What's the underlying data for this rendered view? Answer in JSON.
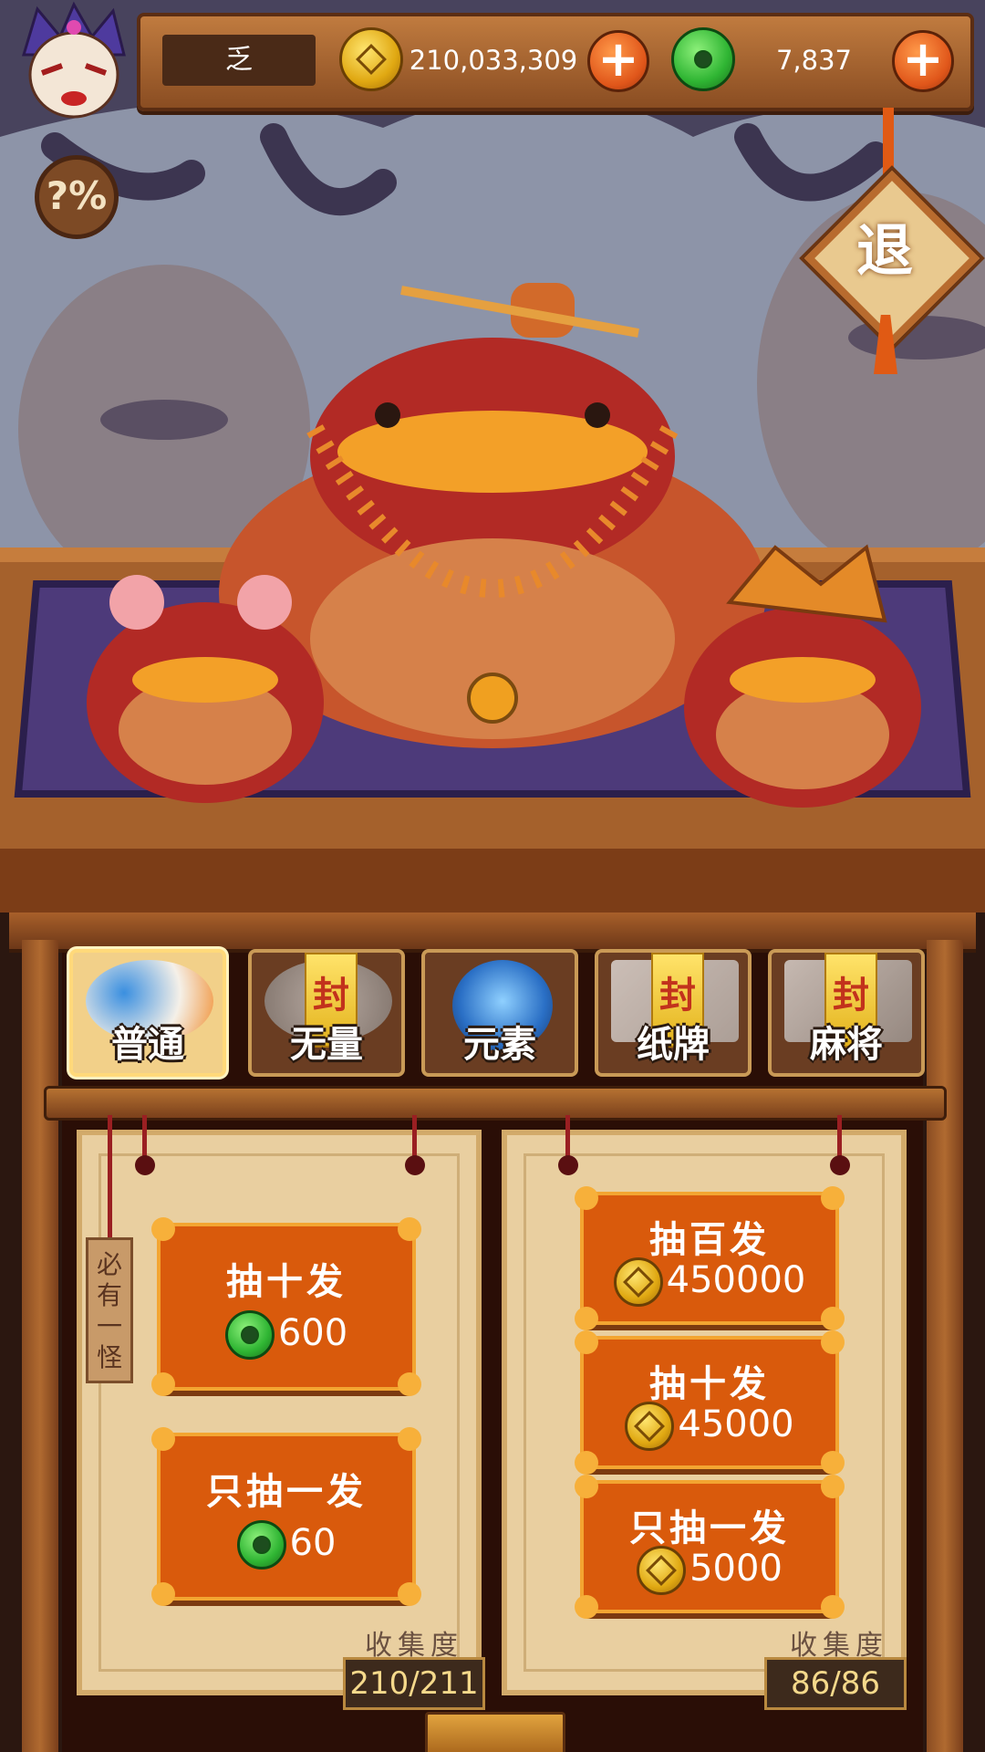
{
  "header": {
    "player_name": "乏",
    "gold": "210,033,309",
    "jade": "7,837",
    "add_symbol": "+"
  },
  "side_buttons": {
    "help_label": "?%",
    "exit_label": "退"
  },
  "tabs": [
    {
      "label": "普通",
      "locked": false,
      "selected": true
    },
    {
      "label": "无量",
      "locked": true,
      "selected": false
    },
    {
      "label": "元素",
      "locked": false,
      "selected": false
    },
    {
      "label": "纸牌",
      "locked": true,
      "selected": false
    },
    {
      "label": "麻将",
      "locked": true,
      "selected": false
    }
  ],
  "seal_char": "封",
  "left_panel": {
    "guarantee_tag": "必有一怪",
    "draw_ten": {
      "title": "抽十发",
      "price": "600",
      "currency": "jade-icon"
    },
    "draw_one": {
      "title": "只抽一发",
      "price": "60",
      "currency": "jade-icon"
    },
    "collection_label": "收集度",
    "collection_value": "210/211"
  },
  "right_panel": {
    "draw_hundred": {
      "title": "抽百发",
      "price": "450000",
      "currency": "gold-coin-icon"
    },
    "draw_ten": {
      "title": "抽十发",
      "price": "45000",
      "currency": "gold-coin-icon"
    },
    "draw_one": {
      "title": "只抽一发",
      "price": "5000",
      "currency": "gold-coin-icon"
    },
    "collection_label": "收集度",
    "collection_value": "86/86"
  },
  "colors": {
    "button_orange": "#d95a0c",
    "gold": "#e0a812",
    "jade": "#2fb533",
    "wood": "#8a4d22"
  }
}
